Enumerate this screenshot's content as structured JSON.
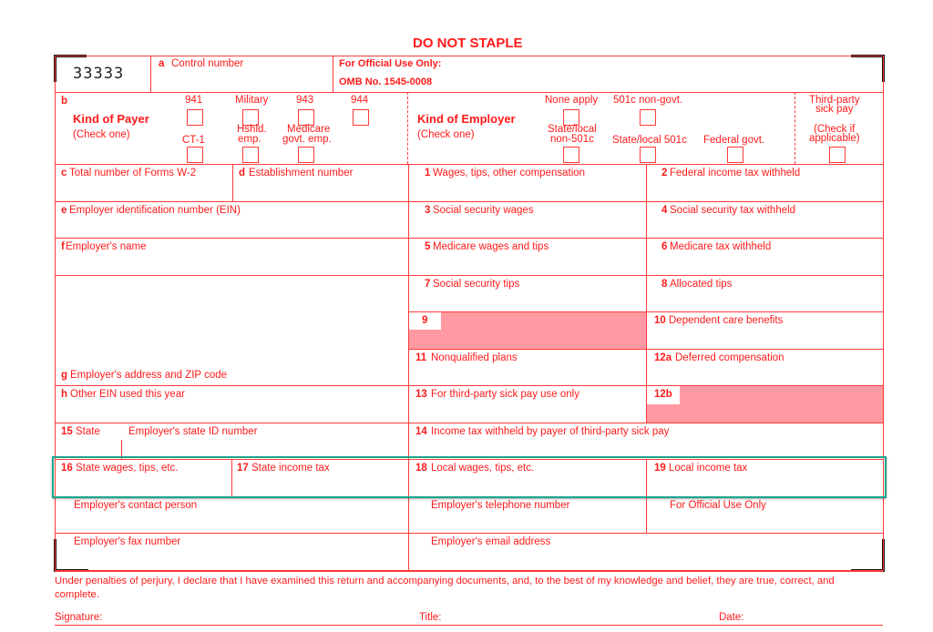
{
  "header": {
    "do_not_staple": "DO NOT STAPLE",
    "form_code": "33333",
    "control_letter": "a",
    "control_label": "Control number",
    "official_use_line1": "For Official Use Only:",
    "official_use_line2": "OMB No. 1545-0008"
  },
  "payer": {
    "letter": "b",
    "title": "Kind of Payer",
    "subtitle": "(Check one)",
    "options_top": [
      {
        "label": "941",
        "checked": false
      },
      {
        "label": "Military",
        "checked": false
      },
      {
        "label": "943",
        "checked": false
      },
      {
        "label": "944",
        "checked": false
      }
    ],
    "options_bottom": [
      {
        "label": "CT-1",
        "checked": false
      },
      {
        "label_line1": "Hshld.",
        "label_line2": "emp.",
        "checked": false
      },
      {
        "label_line1": "Medicare",
        "label_line2": "govt. emp.",
        "checked": false
      }
    ]
  },
  "employer_kind": {
    "title": "Kind of Employer",
    "subtitle": "(Check one)",
    "options_top": [
      {
        "label": "None apply",
        "checked": false
      },
      {
        "label": "501c non-govt.",
        "checked": false
      }
    ],
    "options_bottom": [
      {
        "label_line1": "State/local",
        "label_line2": "non-501c",
        "checked": false
      },
      {
        "label": "State/local 501c",
        "checked": false
      },
      {
        "label": "Federal govt.",
        "checked": false
      }
    ]
  },
  "third_party": {
    "line1": "Third-party",
    "line2": "sick pay",
    "line3": "(Check if",
    "line4": "applicable)",
    "checked": false
  },
  "fields": {
    "c": {
      "num": "c",
      "label": "Total number of Forms W-2",
      "value": ""
    },
    "d": {
      "num": "d",
      "label": "Establishment number",
      "value": ""
    },
    "e": {
      "num": "e",
      "label": "Employer identification number (EIN)",
      "value": ""
    },
    "f": {
      "num": "f",
      "label": " Employer's name",
      "value": ""
    },
    "g": {
      "num": "g",
      "label": "Employer's address and ZIP code",
      "value": ""
    },
    "h": {
      "num": "h",
      "label": "Other EIN used this year",
      "value": ""
    },
    "b15": {
      "num": "15",
      "label": "State",
      "label2": "Employer's state ID number",
      "value": ""
    },
    "b16": {
      "num": "16",
      "label": "State wages, tips, etc.",
      "value": ""
    },
    "b17": {
      "num": "17",
      "label": "State income tax",
      "value": ""
    },
    "b1": {
      "num": "1",
      "label": "Wages, tips, other compensation",
      "value": ""
    },
    "b2": {
      "num": "2",
      "label": "Federal income tax withheld",
      "value": ""
    },
    "b3": {
      "num": "3",
      "label": "Social security wages",
      "value": ""
    },
    "b4": {
      "num": "4",
      "label": "Social security tax withheld",
      "value": ""
    },
    "b5": {
      "num": "5",
      "label": "Medicare wages and tips",
      "value": ""
    },
    "b6": {
      "num": "6",
      "label": "Medicare tax withheld",
      "value": ""
    },
    "b7": {
      "num": "7",
      "label": "Social security tips",
      "value": ""
    },
    "b8": {
      "num": "8",
      "label": "Allocated tips",
      "value": ""
    },
    "b9": {
      "num": "9"
    },
    "b10": {
      "num": "10",
      "label": "Dependent care benefits",
      "value": ""
    },
    "b11": {
      "num": "11",
      "label": "Nonqualified plans",
      "value": ""
    },
    "b12a": {
      "num": "12a",
      "label": "Deferred compensation",
      "value": ""
    },
    "b12b": {
      "num": "12b"
    },
    "b13": {
      "num": "13",
      "label": "For third-party sick pay use only",
      "value": ""
    },
    "b14": {
      "num": "14",
      "label": "Income tax withheld by payer of third-party sick pay",
      "value": ""
    },
    "b18": {
      "num": "18",
      "label": "Local wages, tips, etc.",
      "value": ""
    },
    "b19": {
      "num": "19",
      "label": "Local income tax",
      "value": ""
    },
    "contact": {
      "label": "Employer's contact person",
      "value": ""
    },
    "phone": {
      "label": "Employer's telephone number",
      "value": ""
    },
    "official": {
      "label": "For Official Use Only"
    },
    "fax": {
      "label": "Employer's fax number",
      "value": ""
    },
    "email": {
      "label": "Employer's email address",
      "value": ""
    }
  },
  "footer": {
    "perjury_line1": "Under penalties of perjury, I declare that I have examined this return and accompanying documents, and, to the best of my knowledge and belief, they are true, correct, and",
    "perjury_line2": "complete.",
    "signature_label": "Signature:",
    "title_label": "Title:",
    "date_label": "Date:"
  },
  "colors": {
    "form_red": "#ff1a1a",
    "shade": "#ff9aa2",
    "highlight": "#1aa58c"
  }
}
